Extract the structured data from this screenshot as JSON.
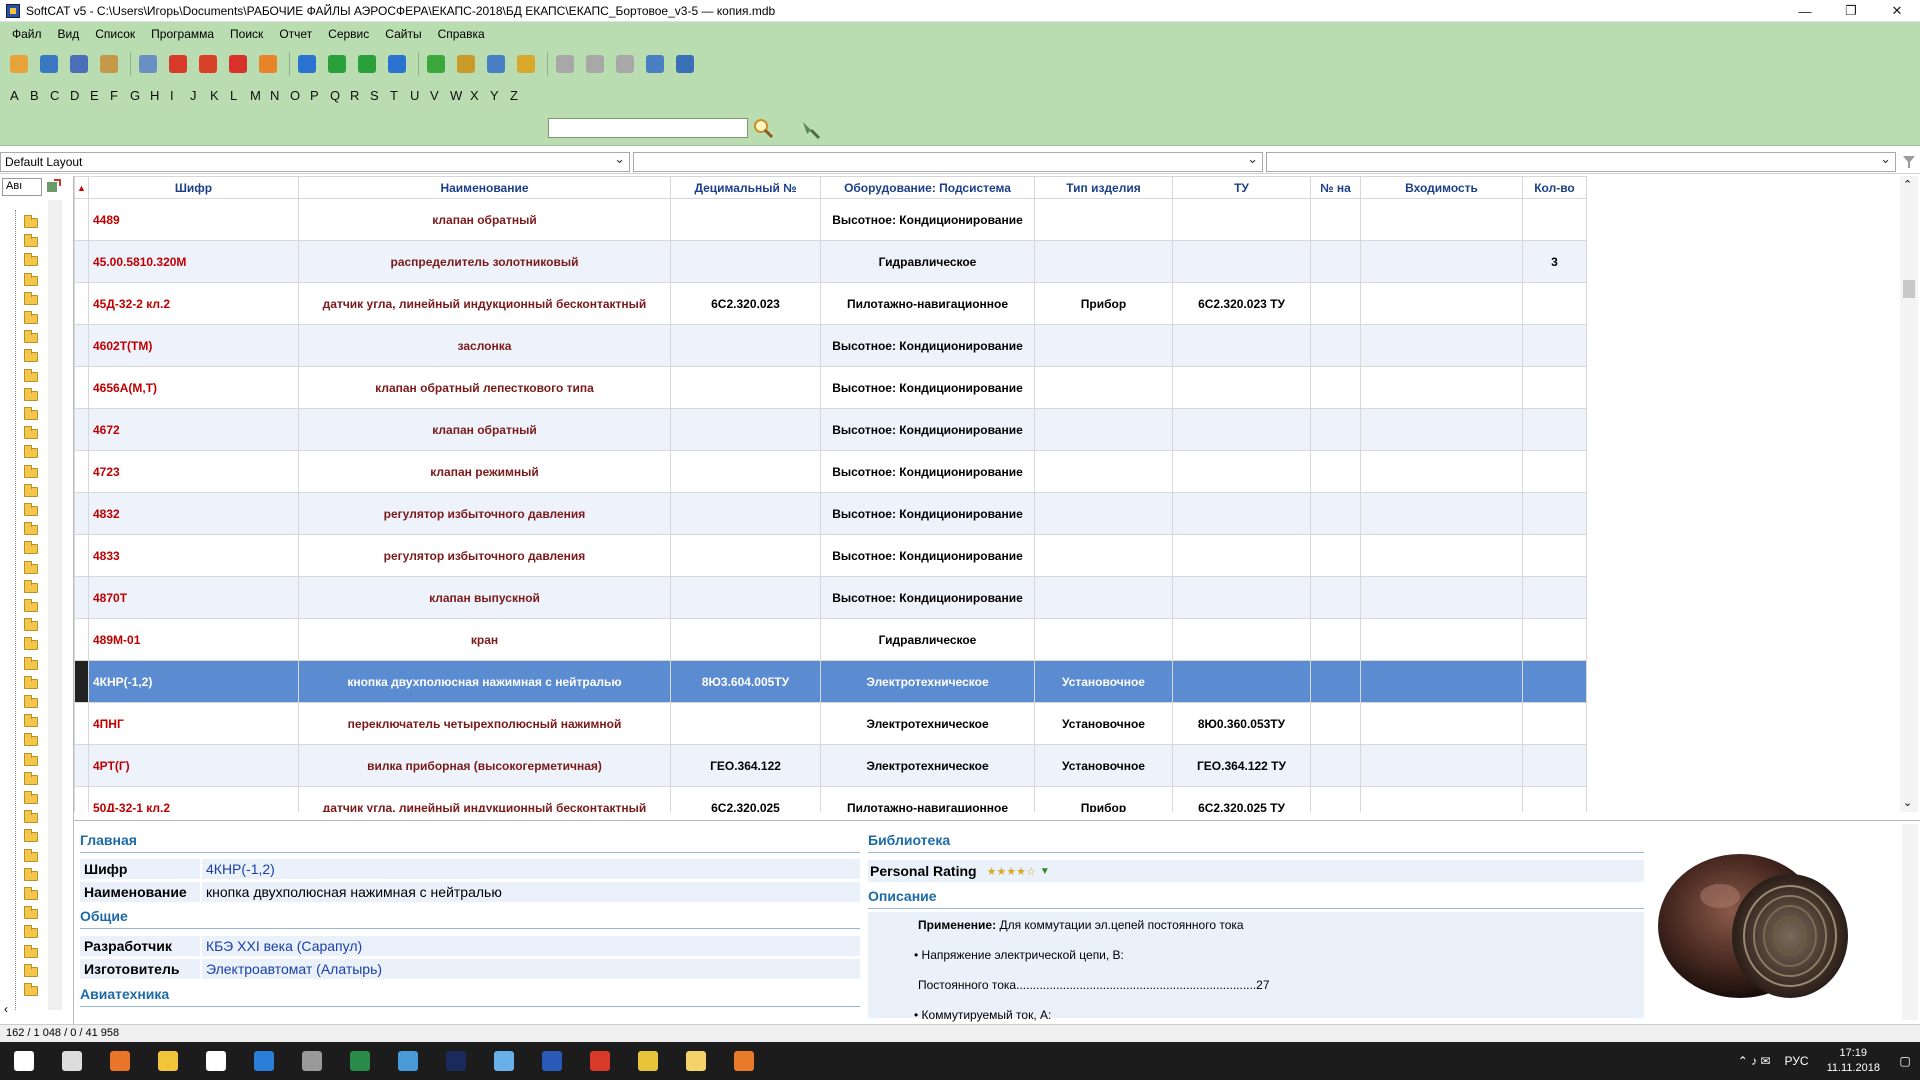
{
  "window": {
    "title": "SoftCAT v5 - C:\\Users\\Игорь\\Documents\\РАБОЧИЕ ФАЙЛЫ АЭРОСФЕРА\\ЕКАПС-2018\\БД ЕКАПС\\ЕКАПС_Бортовое_v3-5 — копия.mdb",
    "minimize": "—",
    "restore": "❐",
    "close": "✕"
  },
  "menu": [
    "Файл",
    "Вид",
    "Список",
    "Программа",
    "Поиск",
    "Отчет",
    "Сервис",
    "Сайты",
    "Справка"
  ],
  "toolbar_icons": [
    {
      "name": "home-icon",
      "color": "#e6a43a"
    },
    {
      "name": "monitor-icon",
      "color": "#3b78c4"
    },
    {
      "name": "grid-icon",
      "color": "#4a6fb8"
    },
    {
      "name": "gears-icon",
      "color": "#c49a4a"
    },
    {
      "name": "preview-icon",
      "color": "#6a8fc4"
    },
    {
      "name": "add-icon",
      "color": "#d83a2a"
    },
    {
      "name": "up-icon",
      "color": "#d8402a"
    },
    {
      "name": "remove-icon",
      "color": "#d8302a"
    },
    {
      "name": "refresh-icon",
      "color": "#e8832a"
    },
    {
      "name": "first-icon",
      "color": "#2a72d0"
    },
    {
      "name": "prev-icon",
      "color": "#2aa03a"
    },
    {
      "name": "next-icon",
      "color": "#2aa03a"
    },
    {
      "name": "last-icon",
      "color": "#2a72d0"
    },
    {
      "name": "check-icon",
      "color": "#3aa83a"
    },
    {
      "name": "edit-check-icon",
      "color": "#c89a2a"
    },
    {
      "name": "table-icon",
      "color": "#4a7fc4"
    },
    {
      "name": "key-icon",
      "color": "#d8a82a"
    },
    {
      "name": "back-icon",
      "color": "#a8a8a8"
    },
    {
      "name": "forward-icon",
      "color": "#a8a8a8"
    },
    {
      "name": "copy-icon",
      "color": "#a8a8a8"
    },
    {
      "name": "export-icon",
      "color": "#4a7fc4"
    },
    {
      "name": "chart-icon",
      "color": "#3a6fb8"
    }
  ],
  "alphabet": [
    "A",
    "B",
    "C",
    "D",
    "E",
    "F",
    "G",
    "H",
    "I",
    "J",
    "K",
    "L",
    "M",
    "N",
    "O",
    "P",
    "Q",
    "R",
    "S",
    "T",
    "U",
    "V",
    "W",
    "X",
    "Y",
    "Z"
  ],
  "layout_combo": "Default Layout",
  "left_combo": "Авı",
  "columns": [
    "Шифр",
    "Наименование",
    "Децимальный №",
    "Оборудование: Подсистема",
    "Тип изделия",
    "ТУ",
    "№ на",
    "Входимость",
    "Кол-во"
  ],
  "rows": [
    {
      "code": "4489",
      "name": "клапан обратный",
      "dec": "",
      "sys": "Высотное: Кондиционирование",
      "type": "",
      "tu": "",
      "no": "",
      "vh": "",
      "qty": ""
    },
    {
      "code": "45.00.5810.320М",
      "name": "распределитель золотниковый",
      "dec": "",
      "sys": "Гидравлическое",
      "type": "",
      "tu": "",
      "no": "",
      "vh": "",
      "qty": "3"
    },
    {
      "code": "45Д-32-2 кл.2",
      "name": "датчик угла, линейный индукционный бесконтактный",
      "dec": "6С2.320.023",
      "sys": "Пилотажно-навигационное",
      "type": "Прибор",
      "tu": "6С2.320.023 ТУ",
      "no": "",
      "vh": "",
      "qty": ""
    },
    {
      "code": "4602Т(ТМ)",
      "name": "заслонка",
      "dec": "",
      "sys": "Высотное: Кондиционирование",
      "type": "",
      "tu": "",
      "no": "",
      "vh": "",
      "qty": ""
    },
    {
      "code": "4656А(М,Т)",
      "name": "клапан обратный лепесткового типа",
      "dec": "",
      "sys": "Высотное: Кондиционирование",
      "type": "",
      "tu": "",
      "no": "",
      "vh": "",
      "qty": ""
    },
    {
      "code": "4672",
      "name": "клапан обратный",
      "dec": "",
      "sys": "Высотное: Кондиционирование",
      "type": "",
      "tu": "",
      "no": "",
      "vh": "",
      "qty": ""
    },
    {
      "code": "4723",
      "name": "клапан режимный",
      "dec": "",
      "sys": "Высотное: Кондиционирование",
      "type": "",
      "tu": "",
      "no": "",
      "vh": "",
      "qty": ""
    },
    {
      "code": "4832",
      "name": "регулятор избыточного давления",
      "dec": "",
      "sys": "Высотное: Кондиционирование",
      "type": "",
      "tu": "",
      "no": "",
      "vh": "",
      "qty": ""
    },
    {
      "code": "4833",
      "name": "регулятор избыточного давления",
      "dec": "",
      "sys": "Высотное: Кондиционирование",
      "type": "",
      "tu": "",
      "no": "",
      "vh": "",
      "qty": ""
    },
    {
      "code": "4870Т",
      "name": "клапан выпускной",
      "dec": "",
      "sys": "Высотное: Кондиционирование",
      "type": "",
      "tu": "",
      "no": "",
      "vh": "",
      "qty": ""
    },
    {
      "code": "489М-01",
      "name": "кран",
      "dec": "",
      "sys": "Гидравлическое",
      "type": "",
      "tu": "",
      "no": "",
      "vh": "",
      "qty": ""
    },
    {
      "code": "4КНР(-1,2)",
      "name": "кнопка двухполюсная нажимная с нейтралью",
      "dec": "8Ю3.604.005ТУ",
      "sys": "Электротехническое",
      "type": "Установочное",
      "tu": "",
      "no": "",
      "vh": "",
      "qty": "",
      "selected": true
    },
    {
      "code": "4ПНГ",
      "name": "переключатель четырехполюсный нажимной",
      "dec": "",
      "sys": "Электротехническое",
      "type": "Установочное",
      "tu": "8Ю0.360.053ТУ",
      "no": "",
      "vh": "",
      "qty": ""
    },
    {
      "code": "4РТ(Г)",
      "name": "вилка приборная (высокогерметичная)",
      "dec": "ГЕО.364.122",
      "sys": "Электротехническое",
      "type": "Установочное",
      "tu": "ГЕО.364.122 ТУ",
      "no": "",
      "vh": "",
      "qty": ""
    },
    {
      "code": "50Д-32-1 кл.2",
      "name": "датчик угла, линейный индукционный бесконтактный",
      "dec": "6С2.320.025",
      "sys": "Пилотажно-навигационное",
      "type": "Прибор",
      "tu": "6С2.320.025 ТУ",
      "no": "",
      "vh": "",
      "qty": ""
    }
  ],
  "details": {
    "main_header": "Главная",
    "code_label": "Шифр",
    "code_value": "4КНР(-1,2)",
    "name_label": "Наименование",
    "name_value": "кнопка двухполюсная нажимная с нейтралью",
    "general_header": "Общие",
    "dev_label": "Разработчик",
    "dev_value": "КБЭ XXI века (Сарапул)",
    "maker_label": "Изготовитель",
    "maker_value": "Электроавтомат (Алатырь)",
    "avia_header": "Авиатехника",
    "library_header": "Библиотека",
    "rating_label": "Personal Rating",
    "rating_stars": "★★★★☆",
    "desc_header": "Описание",
    "app_label": "Применение:",
    "app_value": "Для коммутации эл.цепей постоянного тока",
    "bullet1": "Напряжение электрической цепи, В:",
    "dc_line": "Постоянного тока........................................................................27",
    "bullet2": "Коммутируемый ток, А:"
  },
  "status": "162 / 1 048 / 0 / 41 958",
  "tray": {
    "lang": "РУС",
    "time": "17:19",
    "date": "11.11.2018"
  },
  "taskbar_icons": [
    {
      "name": "start-icon",
      "color": "#ffffff"
    },
    {
      "name": "taskview-icon",
      "color": "#dddddd"
    },
    {
      "name": "firefox-icon",
      "color": "#e8752a"
    },
    {
      "name": "explorer-icon",
      "color": "#f2c43a"
    },
    {
      "name": "store-icon",
      "color": "#ffffff"
    },
    {
      "name": "edge-icon",
      "color": "#2a7fd8"
    },
    {
      "name": "app-icon",
      "color": "#9a9a9a"
    },
    {
      "name": "excel-icon",
      "color": "#2a8a4a"
    },
    {
      "name": "project-icon",
      "color": "#4a9ad8"
    },
    {
      "name": "photoshop-icon",
      "color": "#1a2a5a"
    },
    {
      "name": "notepad-icon",
      "color": "#6ab0e8"
    },
    {
      "name": "word-icon",
      "color": "#2a5ab8"
    },
    {
      "name": "pdf-icon",
      "color": "#d83a2a"
    },
    {
      "name": "chrome-icon",
      "color": "#e8c43a"
    },
    {
      "name": "softcat-icon",
      "color": "#f4d46a"
    },
    {
      "name": "media-icon",
      "color": "#e87a2a"
    }
  ]
}
